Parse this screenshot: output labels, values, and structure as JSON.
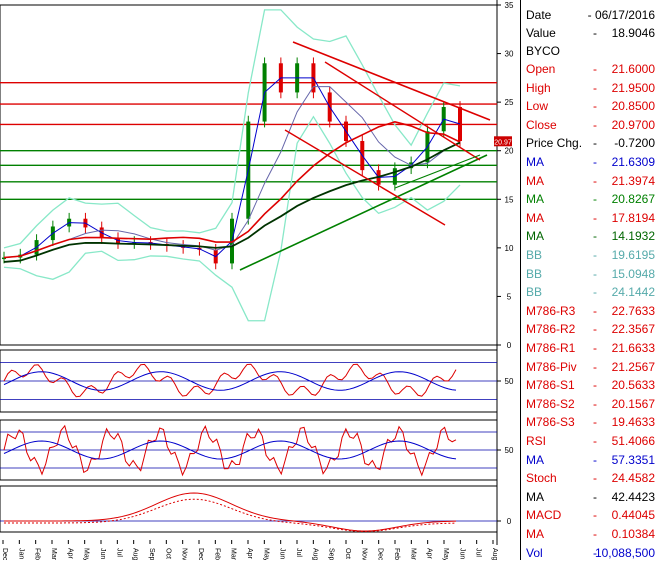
{
  "chart_data": {
    "type": "line",
    "symbol": "BYCO",
    "x_tick_labels": [
      "Dec 2014",
      "Jan",
      "Feb",
      "Mar",
      "Apr",
      "May",
      "Jun",
      "Jul",
      "Aug",
      "Sep",
      "Oct",
      "Nov",
      "Dec 2015",
      "Feb",
      "Mar",
      "Apr",
      "May",
      "Jun",
      "Jul",
      "Aug",
      "Sep",
      "Oct",
      "Nov",
      "Dec 2016",
      "Feb",
      "Mar",
      "Apr",
      "May",
      "Jun",
      "Jul",
      "Aug"
    ],
    "price_axis": {
      "ylim": [
        0,
        35
      ],
      "ticks": [
        "35",
        "30",
        "25",
        "20",
        "15",
        "10",
        "5",
        "0"
      ]
    },
    "price_close_approx": [
      9.0,
      9.3,
      10.8,
      12.2,
      13.0,
      12.1,
      11.0,
      10.5,
      10.6,
      10.4,
      10.2,
      10.0,
      9.8,
      8.4,
      13.0,
      23.0,
      29.0,
      26.0,
      29.0,
      26.0,
      23.0,
      21.0,
      18.0,
      16.5,
      18.2,
      18.8,
      22.0,
      24.5,
      21.0
    ],
    "horizontal_levels": [
      {
        "value": 27.0,
        "color": "#dd0000"
      },
      {
        "value": 24.8,
        "color": "#dd0000"
      },
      {
        "value": 22.7,
        "color": "#dd0000"
      },
      {
        "value": 20.0,
        "color": "#008000"
      },
      {
        "value": 18.5,
        "color": "#008000"
      },
      {
        "value": 16.8,
        "color": "#008000"
      },
      {
        "value": 15.0,
        "color": "#008000"
      }
    ],
    "current_price_marker": "20.97",
    "oscillator_panels": [
      {
        "name": "RSI panel",
        "ylim": [
          0,
          100
        ],
        "tick": "50",
        "level_lines": [
          80,
          50,
          20
        ]
      },
      {
        "name": "Stoch panel",
        "ylim": [
          0,
          100
        ],
        "tick": "50",
        "level_lines": [
          80,
          50,
          20
        ]
      },
      {
        "name": "MACD panel",
        "tick": "0",
        "zero_line": true
      }
    ],
    "colors": {
      "candle_up": "#008000",
      "candle_down": "#dd0000",
      "ma_short": "#0000cc",
      "ma_long": "#dd0000",
      "ma_dark": "#003300",
      "bollinger": "#88e8c8"
    }
  },
  "info": {
    "date_label": "Date",
    "date_value": "06/17/2016",
    "value_label": "Value",
    "value_value": "18.9046",
    "symbol": "BYCO",
    "rows": [
      {
        "label": "Open",
        "value": "21.6000",
        "color": "#dd0000"
      },
      {
        "label": "High",
        "value": "21.9500",
        "color": "#dd0000"
      },
      {
        "label": "Low",
        "value": "20.8500",
        "color": "#dd0000"
      },
      {
        "label": "Close",
        "value": "20.9700",
        "color": "#dd0000"
      },
      {
        "label": "Price Chg.",
        "value": "-0.7200",
        "color": "#000000"
      },
      {
        "label": "MA",
        "value": "21.6309",
        "color": "#0000cc"
      },
      {
        "label": "MA",
        "value": "21.3974",
        "color": "#dd0000"
      },
      {
        "label": "MA",
        "value": "20.8267",
        "color": "#008000"
      },
      {
        "label": "MA",
        "value": "17.8194",
        "color": "#dd0000"
      },
      {
        "label": "MA",
        "value": "14.1932",
        "color": "#006600"
      },
      {
        "label": "BB",
        "value": "19.6195",
        "color": "#55aaaa"
      },
      {
        "label": "BB",
        "value": "15.0948",
        "color": "#55aaaa"
      },
      {
        "label": "BB",
        "value": "24.1442",
        "color": "#55aaaa"
      },
      {
        "label": "M786-R3",
        "value": "22.7633",
        "color": "#dd0000"
      },
      {
        "label": "M786-R2",
        "value": "22.3567",
        "color": "#dd0000"
      },
      {
        "label": "M786-R1",
        "value": "21.6633",
        "color": "#dd0000"
      },
      {
        "label": "M786-Piv",
        "value": "21.2567",
        "color": "#dd0000"
      },
      {
        "label": "M786-S1",
        "value": "20.5633",
        "color": "#dd0000"
      },
      {
        "label": "M786-S2",
        "value": "20.1567",
        "color": "#dd0000"
      },
      {
        "label": "M786-S3",
        "value": "19.4633",
        "color": "#dd0000"
      },
      {
        "label": "RSI",
        "value": "51.4066",
        "color": "#dd0000"
      },
      {
        "label": "MA",
        "value": "57.3351",
        "color": "#0000cc"
      },
      {
        "label": "Stoch",
        "value": "24.4582",
        "color": "#dd0000"
      },
      {
        "label": "MA",
        "value": "42.4423",
        "color": "#000000"
      },
      {
        "label": "MACD",
        "value": "0.44045",
        "color": "#dd0000"
      },
      {
        "label": "MA",
        "value": "0.10384",
        "color": "#dd0000"
      },
      {
        "label": "Vol",
        "value": "10,088,500",
        "color": "#0000cc"
      }
    ]
  }
}
